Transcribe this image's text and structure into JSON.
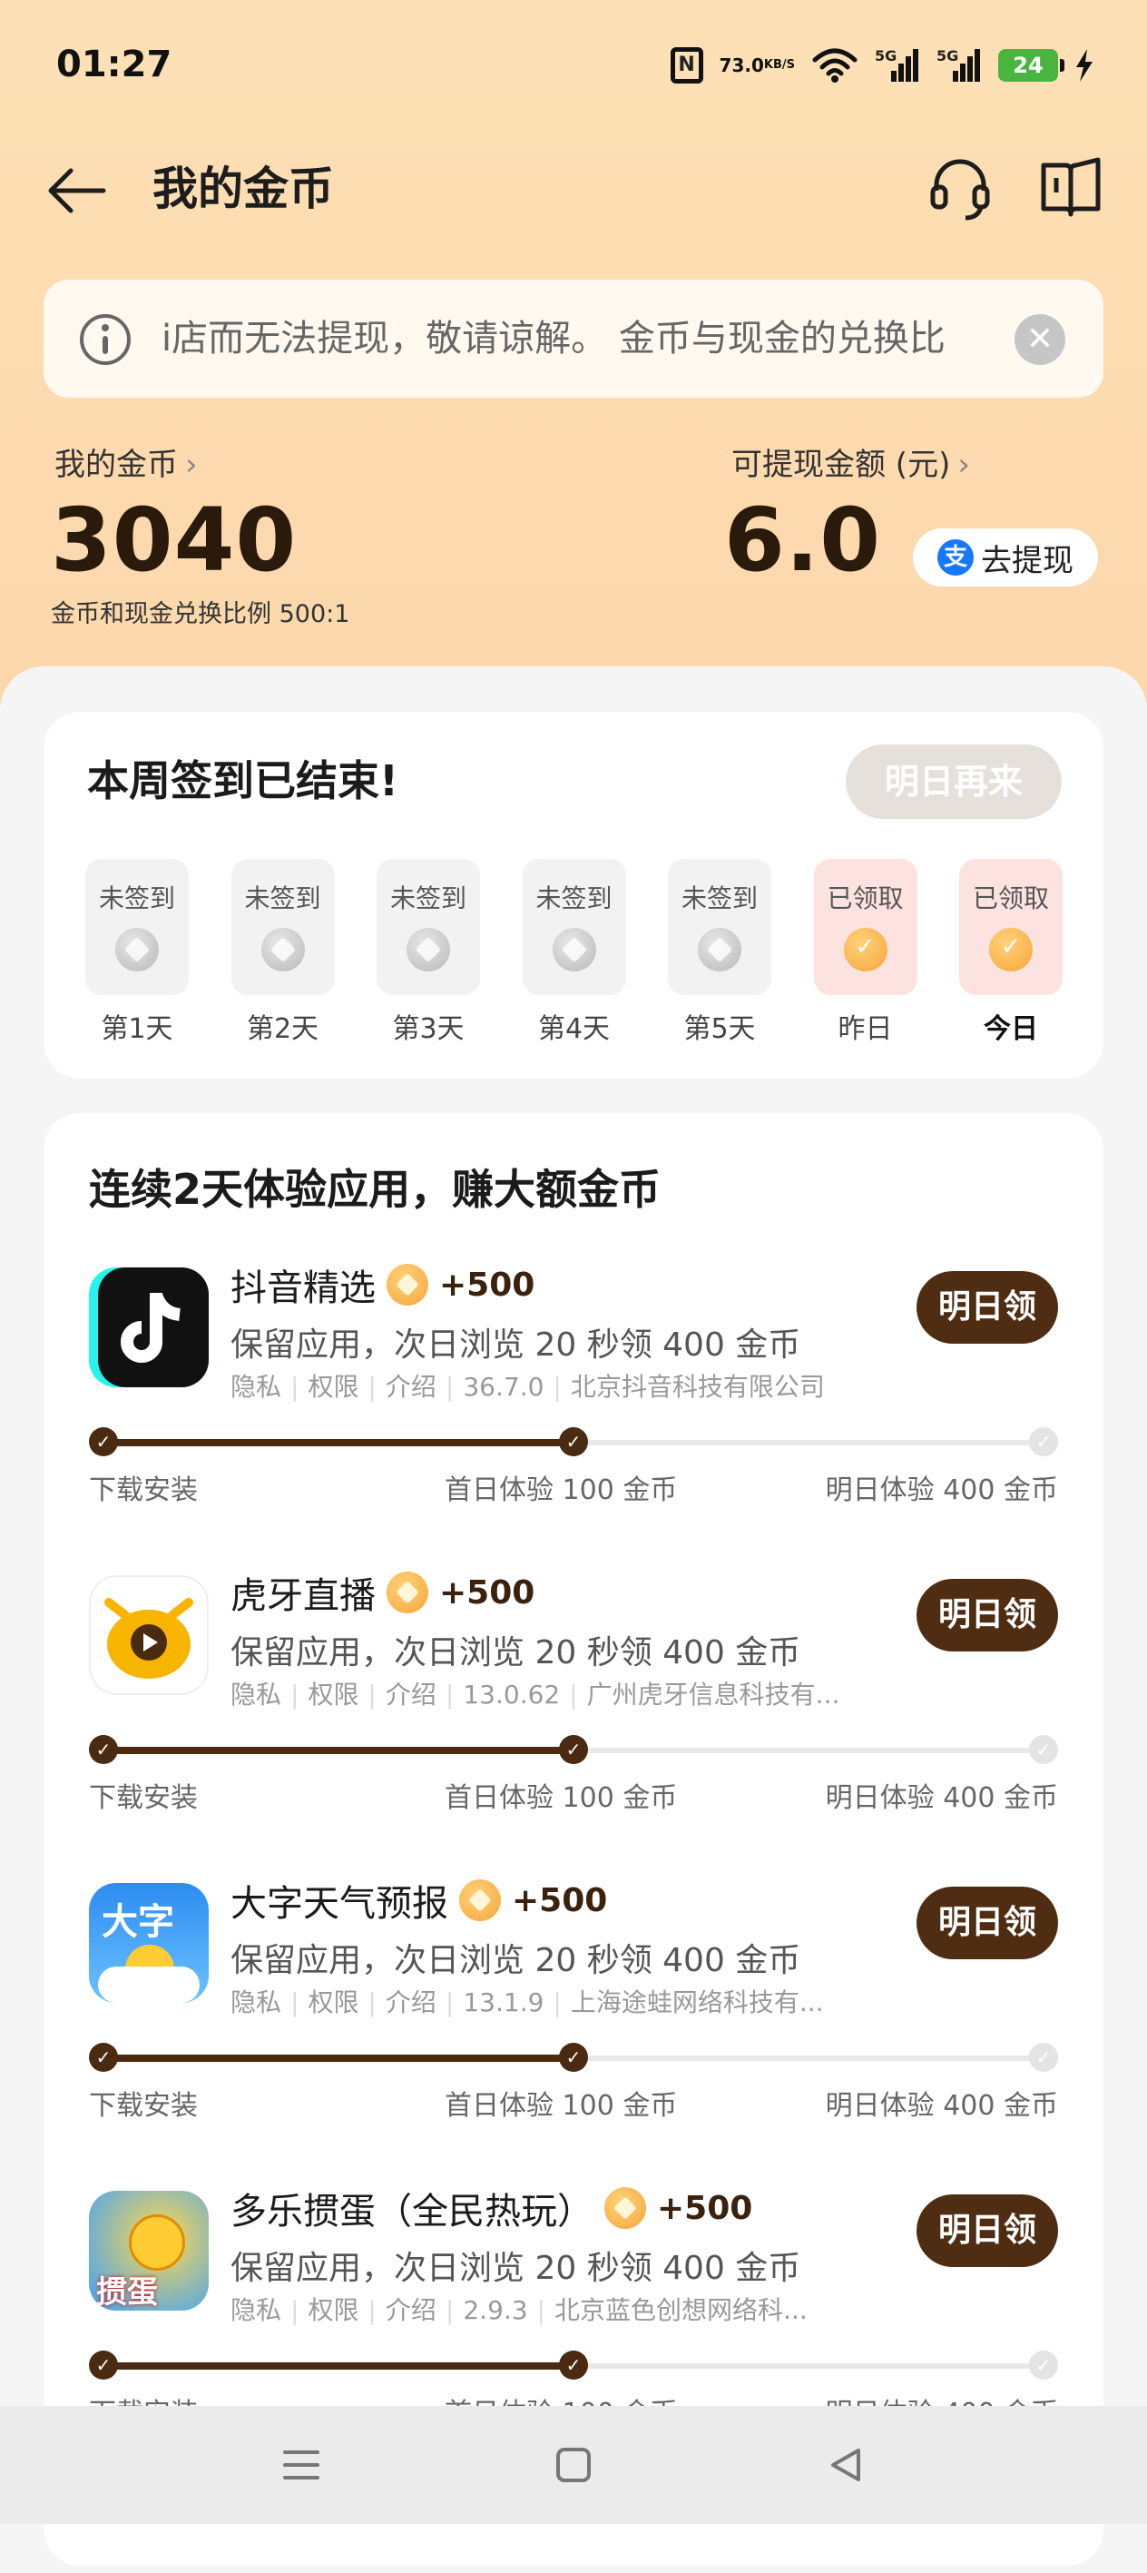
{
  "status_bar": {
    "time": "01:27",
    "nfc": "N",
    "speed_value": "73.0",
    "speed_unit": "KB/S",
    "battery": "24",
    "signal1": "5G",
    "signal2": "5G"
  },
  "header": {
    "title": "我的金币"
  },
  "notice": {
    "text": "i店而无法提现，敬请谅解。 金币与现金的兑换比"
  },
  "coins": {
    "label": "我的金币",
    "value": "3040",
    "rate": "金币和现金兑换比例 500:1",
    "cash_label": "可提现金额 (元)",
    "cash_value": "6.0",
    "withdraw_label": "去提现",
    "withdraw_icon": "支"
  },
  "signin": {
    "title": "本周签到已结束!",
    "button": "明日再来",
    "days": [
      {
        "status": "未签到",
        "label": "第1天",
        "done": false
      },
      {
        "status": "未签到",
        "label": "第2天",
        "done": false
      },
      {
        "status": "未签到",
        "label": "第3天",
        "done": false
      },
      {
        "status": "未签到",
        "label": "第4天",
        "done": false
      },
      {
        "status": "未签到",
        "label": "第5天",
        "done": false
      },
      {
        "status": "已领取",
        "label": "昨日",
        "done": true
      },
      {
        "status": "已领取",
        "label": "今日",
        "done": true
      }
    ]
  },
  "tasks": {
    "title": "连续2天体验应用，赚大额金币",
    "progress_labels": [
      "下载安装",
      "首日体验 100 金币",
      "明日体验 400 金币"
    ],
    "items": [
      {
        "name": "抖音精选",
        "reward": "+500",
        "desc": "保留应用，次日浏览 20 秒领 400 金币",
        "meta": [
          "隐私",
          "权限",
          "介绍",
          "36.7.0",
          "北京抖音科技有限公司"
        ],
        "button": "明日领",
        "progress": 0.5
      },
      {
        "name": "虎牙直播",
        "reward": "+500",
        "desc": "保留应用，次日浏览 20 秒领 400 金币",
        "meta": [
          "隐私",
          "权限",
          "介绍",
          "13.0.62",
          "广州虎牙信息科技有..."
        ],
        "button": "明日领",
        "progress": 0.5
      },
      {
        "name": "大字天气预报",
        "reward": "+500",
        "desc": "保留应用，次日浏览 20 秒领 400 金币",
        "meta": [
          "隐私",
          "权限",
          "介绍",
          "13.1.9",
          "上海途蛙网络科技有..."
        ],
        "button": "明日领",
        "progress": 0.5,
        "icon_text": "大字"
      },
      {
        "name": "多乐掼蛋（全民热玩）",
        "reward": "+500",
        "desc": "保留应用，次日浏览 20 秒领 400 金币",
        "meta": [
          "隐私",
          "权限",
          "介绍",
          "2.9.3",
          "北京蓝色创想网络科..."
        ],
        "button": "明日领",
        "progress": 0.5,
        "icon_text": "掼蛋"
      }
    ]
  },
  "colors": {
    "accent_dark": "#4f2d12",
    "header_bg": "#fde1b6",
    "coin_gold": "#f6a53a"
  }
}
